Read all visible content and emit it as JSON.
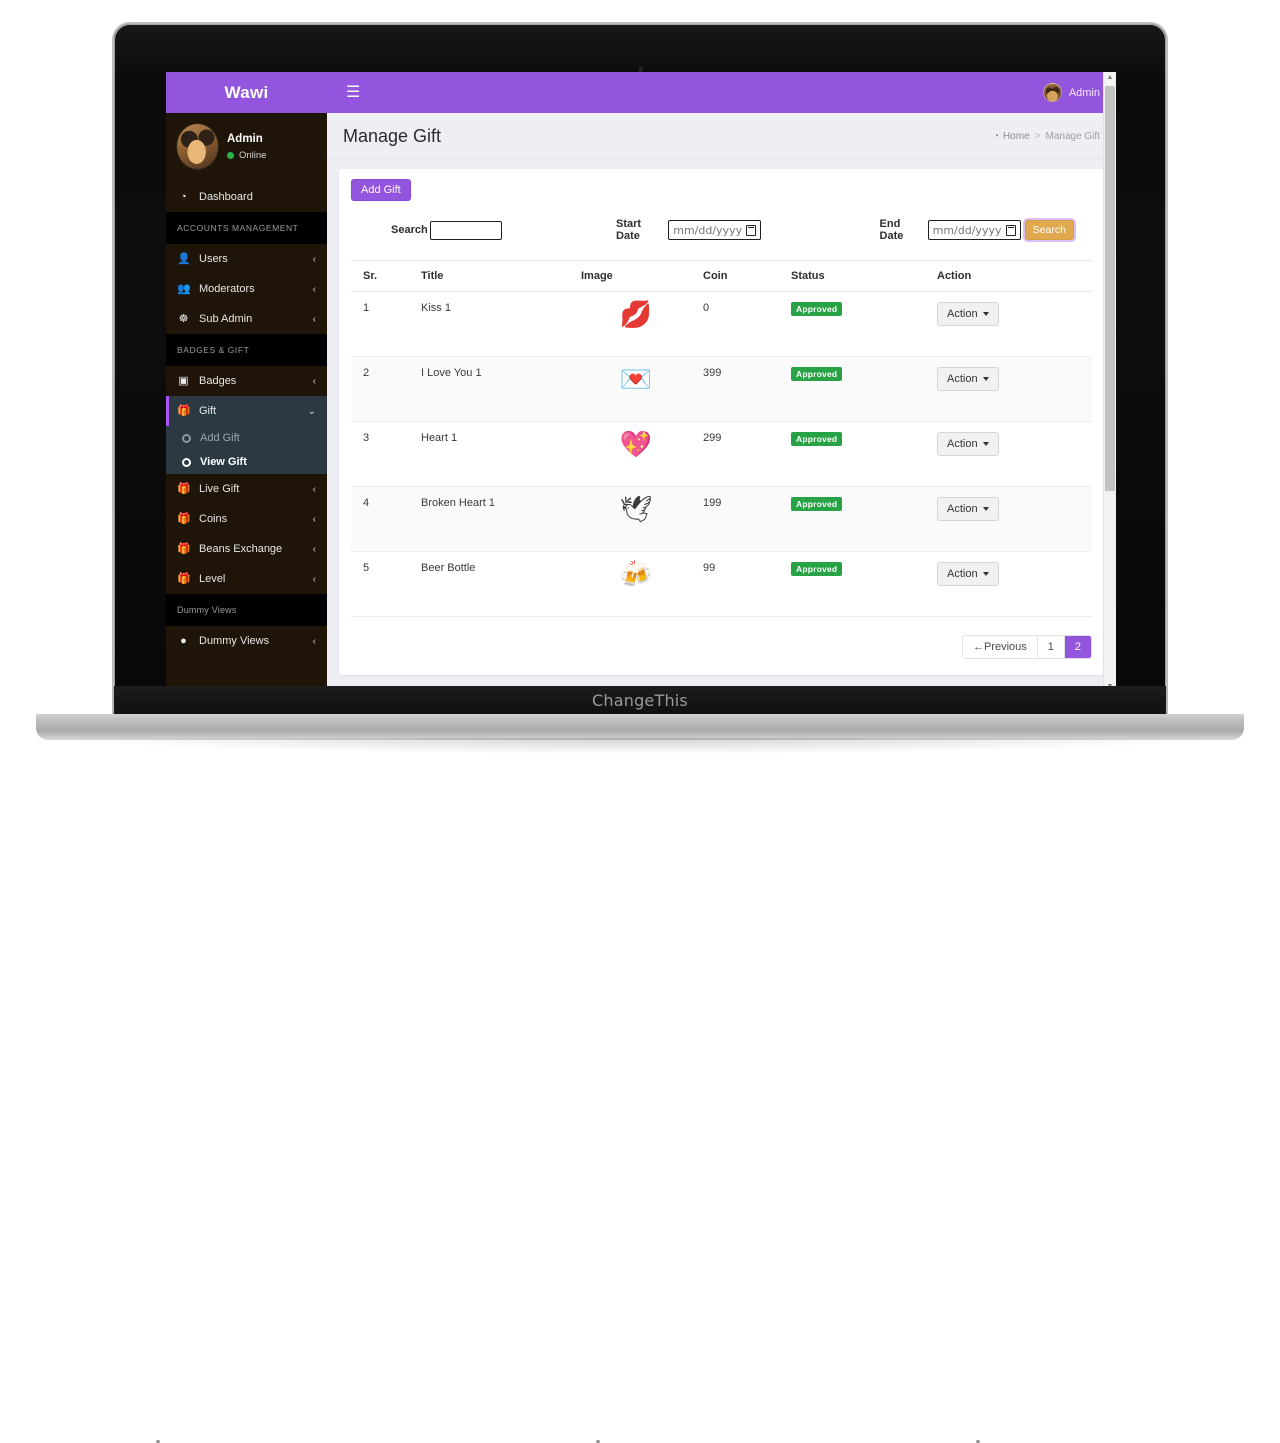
{
  "device": {
    "brand_text": "ChangeThis"
  },
  "navbar": {
    "brand": "Wawi",
    "menu_toggle_icon": "hamburger-icon",
    "user_name": "Admin"
  },
  "sidebar": {
    "profile": {
      "name": "Admin",
      "status": "Online",
      "status_color": "#27b54a"
    },
    "items": [
      {
        "type": "link",
        "label": "Dashboard",
        "icon": "dashboard-icon",
        "chevron": ""
      },
      {
        "type": "header",
        "label": "ACCOUNTS MANAGEMENT"
      },
      {
        "type": "link",
        "label": "Users",
        "icon": "user-icon",
        "chevron": "‹"
      },
      {
        "type": "link",
        "label": "Moderators",
        "icon": "users-group-icon",
        "chevron": "‹"
      },
      {
        "type": "link",
        "label": "Sub Admin",
        "icon": "globe-icon",
        "chevron": "‹"
      },
      {
        "type": "header",
        "label": "BADGES & GIFT"
      },
      {
        "type": "link",
        "label": "Badges",
        "icon": "badge-icon",
        "chevron": "‹"
      },
      {
        "type": "active",
        "label": "Gift",
        "icon": "gift-icon",
        "chevron": "⌄"
      },
      {
        "type": "link",
        "label": "Live Gift",
        "icon": "gift-icon",
        "chevron": "‹"
      },
      {
        "type": "link",
        "label": "Coins",
        "icon": "gift-icon",
        "chevron": "‹"
      },
      {
        "type": "link",
        "label": "Beans Exchange",
        "icon": "gift-icon",
        "chevron": "‹"
      },
      {
        "type": "link",
        "label": "Level",
        "icon": "gift-icon",
        "chevron": "‹"
      },
      {
        "type": "header",
        "label": "Dummy Views"
      },
      {
        "type": "link",
        "label": "Dummy Views",
        "icon": "circle-icon",
        "chevron": "‹"
      }
    ],
    "submenu": [
      {
        "label": "Add Gift",
        "selected": false
      },
      {
        "label": "View Gift",
        "selected": true
      }
    ],
    "labels": {
      "dashboard": "Dashboard",
      "accounts_management": "ACCOUNTS MANAGEMENT",
      "users": "Users",
      "moderators": "Moderators",
      "sub_admin": "Sub Admin",
      "badges_gift": "BADGES & GIFT",
      "badges": "Badges",
      "gift": "Gift",
      "add_gift": "Add Gift",
      "view_gift": "View Gift",
      "live_gift": "Live Gift",
      "coins": "Coins",
      "beans_exchange": "Beans Exchange",
      "level": "Level",
      "dummy_views_header": "Dummy Views",
      "dummy_views": "Dummy Views"
    }
  },
  "page": {
    "title": "Manage Gift",
    "breadcrumb": {
      "home": "Home",
      "separator": ">",
      "current": "Manage Gift"
    }
  },
  "toolbar": {
    "add_gift_label": "Add Gift",
    "add_gift_color": "#9355de"
  },
  "filters": {
    "search_label": "Search",
    "search_value": "",
    "search_placeholder": "",
    "start_date_label": "Start Date",
    "start_date_placeholder": "mm/dd/yyyy",
    "end_date_label": "End Date",
    "end_date_placeholder": "mm/dd/yyyy",
    "search_button_label": "Search",
    "search_button_color": "#e0a94e"
  },
  "table": {
    "columns": [
      "Sr.",
      "Title",
      "Image",
      "Coin",
      "Status",
      "Action"
    ],
    "rows": [
      {
        "sr": "1",
        "title": "Kiss 1",
        "image_icon": "lips-emoji",
        "glyph": "💋",
        "coin": "0",
        "status": "Approved",
        "action": "Action"
      },
      {
        "sr": "2",
        "title": "I Love You 1",
        "image_icon": "love-you-text-emoji",
        "glyph": "💌",
        "coin": "399",
        "status": "Approved",
        "action": "Action"
      },
      {
        "sr": "3",
        "title": "Heart 1",
        "image_icon": "growing-heart-emoji",
        "glyph": "💖",
        "coin": "299",
        "status": "Approved",
        "action": "Action"
      },
      {
        "sr": "4",
        "title": "Broken Heart 1",
        "image_icon": "winged-heart-emoji",
        "glyph": "🕊",
        "coin": "199",
        "status": "Approved",
        "action": "Action"
      },
      {
        "sr": "5",
        "title": "Beer Bottle",
        "image_icon": "beer-bottle-emoji",
        "glyph": "🍻",
        "coin": "99",
        "status": "Approved",
        "action": "Action"
      }
    ],
    "status_color": "#27a244"
  },
  "pagination": {
    "previous_label": "←Previous",
    "pages": [
      {
        "label": "1",
        "active": false
      },
      {
        "label": "2",
        "active": true
      }
    ]
  }
}
